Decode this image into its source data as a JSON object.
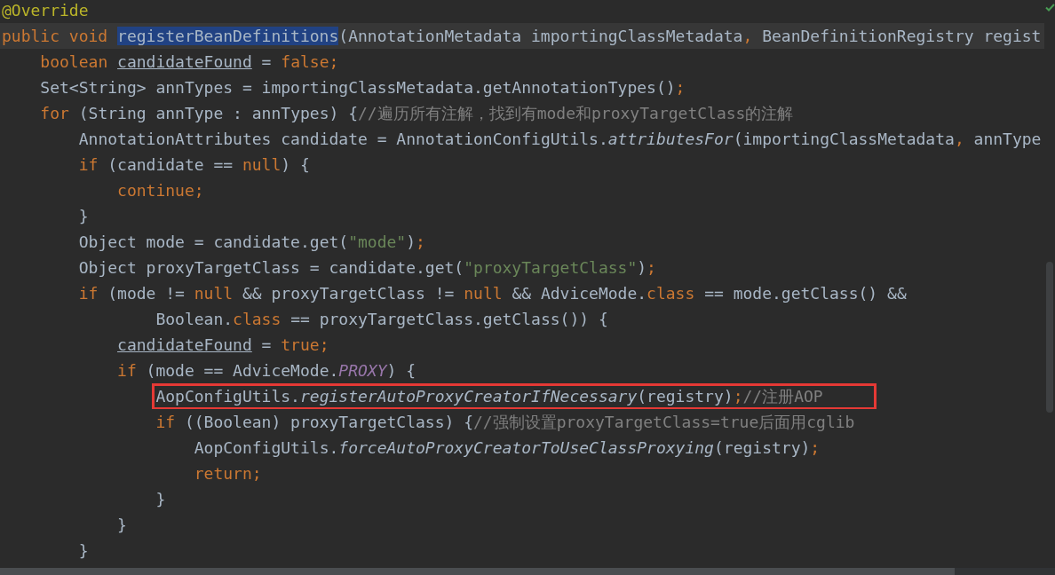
{
  "editor": {
    "lines": [
      {
        "current": false,
        "boxed": false,
        "tokens": [
          {
            "kind": "annotation",
            "text": "@Override"
          }
        ]
      },
      {
        "current": true,
        "boxed": false,
        "tokens": [
          {
            "kind": "keyword",
            "text": "public void "
          },
          {
            "kind": "selected",
            "text": "registerBeanDefinitions"
          },
          {
            "kind": "plain",
            "text": "(AnnotationMetadata importingClassMetadata"
          },
          {
            "kind": "keyword",
            "text": ", "
          },
          {
            "kind": "plain",
            "text": "BeanDefinitionRegistry regist"
          }
        ]
      },
      {
        "current": false,
        "boxed": false,
        "tokens": [
          {
            "kind": "keyword",
            "text": "    boolean "
          },
          {
            "kind": "variable",
            "text": "candidateFound"
          },
          {
            "kind": "plain",
            "text": " = "
          },
          {
            "kind": "keyword",
            "text": "false;"
          }
        ]
      },
      {
        "current": false,
        "boxed": false,
        "tokens": [
          {
            "kind": "plain",
            "text": "    Set<String> annTypes = importingClassMetadata.getAnnotationTypes()"
          },
          {
            "kind": "keyword",
            "text": ";"
          }
        ]
      },
      {
        "current": false,
        "boxed": false,
        "tokens": [
          {
            "kind": "keyword",
            "text": "    for "
          },
          {
            "kind": "plain",
            "text": "(String annType : annTypes) {"
          },
          {
            "kind": "comment",
            "text": "//遍历所有注解，找到有mode和proxyTargetClass的注解"
          }
        ]
      },
      {
        "current": false,
        "boxed": false,
        "tokens": [
          {
            "kind": "plain",
            "text": "        AnnotationAttributes candidate = AnnotationConfigUtils."
          },
          {
            "kind": "method",
            "text": "attributesFor"
          },
          {
            "kind": "plain",
            "text": "(importingClassMetadata"
          },
          {
            "kind": "keyword",
            "text": ", "
          },
          {
            "kind": "plain",
            "text": "annType"
          }
        ]
      },
      {
        "current": false,
        "boxed": false,
        "tokens": [
          {
            "kind": "keyword",
            "text": "        if "
          },
          {
            "kind": "plain",
            "text": "(candidate == "
          },
          {
            "kind": "keyword",
            "text": "null"
          },
          {
            "kind": "plain",
            "text": ") {"
          }
        ]
      },
      {
        "current": false,
        "boxed": false,
        "tokens": [
          {
            "kind": "keyword",
            "text": "            continue;"
          }
        ]
      },
      {
        "current": false,
        "boxed": false,
        "tokens": [
          {
            "kind": "plain",
            "text": "        }"
          }
        ]
      },
      {
        "current": false,
        "boxed": false,
        "tokens": [
          {
            "kind": "plain",
            "text": "        Object mode = candidate.get("
          },
          {
            "kind": "string",
            "text": "\"mode\""
          },
          {
            "kind": "plain",
            "text": ")"
          },
          {
            "kind": "keyword",
            "text": ";"
          }
        ]
      },
      {
        "current": false,
        "boxed": false,
        "tokens": [
          {
            "kind": "plain",
            "text": "        Object proxyTargetClass = candidate.get("
          },
          {
            "kind": "string",
            "text": "\"proxyTargetClass\""
          },
          {
            "kind": "plain",
            "text": ")"
          },
          {
            "kind": "keyword",
            "text": ";"
          }
        ]
      },
      {
        "current": false,
        "boxed": false,
        "tokens": [
          {
            "kind": "keyword",
            "text": "        if "
          },
          {
            "kind": "plain",
            "text": "(mode != "
          },
          {
            "kind": "keyword",
            "text": "null "
          },
          {
            "kind": "plain",
            "text": "&& proxyTargetClass != "
          },
          {
            "kind": "keyword",
            "text": "null "
          },
          {
            "kind": "plain",
            "text": "&& AdviceMode."
          },
          {
            "kind": "keyword",
            "text": "class "
          },
          {
            "kind": "plain",
            "text": "== mode.getClass() &&"
          }
        ]
      },
      {
        "current": false,
        "boxed": false,
        "tokens": [
          {
            "kind": "plain",
            "text": "                Boolean."
          },
          {
            "kind": "keyword",
            "text": "class "
          },
          {
            "kind": "plain",
            "text": "== proxyTargetClass.getClass()) {"
          }
        ]
      },
      {
        "current": false,
        "boxed": false,
        "tokens": [
          {
            "kind": "variable",
            "text": "            candidateFound"
          },
          {
            "kind": "plain",
            "text": " = "
          },
          {
            "kind": "keyword",
            "text": "true;"
          }
        ]
      },
      {
        "current": false,
        "boxed": false,
        "tokens": [
          {
            "kind": "keyword",
            "text": "            if "
          },
          {
            "kind": "plain",
            "text": "(mode == AdviceMode."
          },
          {
            "kind": "constant",
            "text": "PROXY"
          },
          {
            "kind": "plain",
            "text": ") {"
          }
        ]
      },
      {
        "current": false,
        "boxed": true,
        "tokens": [
          {
            "kind": "plain",
            "text": "                AopConfigUtils."
          },
          {
            "kind": "method",
            "text": "registerAutoProxyCreatorIfNecessary"
          },
          {
            "kind": "plain",
            "text": "(registry)"
          },
          {
            "kind": "keyword",
            "text": ";"
          },
          {
            "kind": "comment",
            "text": "//注册AOP"
          }
        ]
      },
      {
        "current": false,
        "boxed": false,
        "tokens": [
          {
            "kind": "keyword",
            "text": "                if "
          },
          {
            "kind": "plain",
            "text": "((Boolean) proxyTargetClass) {"
          },
          {
            "kind": "comment",
            "text": "//强制设置proxyTargetClass=true后面用cglib"
          }
        ]
      },
      {
        "current": false,
        "boxed": false,
        "tokens": [
          {
            "kind": "plain",
            "text": "                    AopConfigUtils."
          },
          {
            "kind": "method",
            "text": "forceAutoProxyCreatorToUseClassProxying"
          },
          {
            "kind": "plain",
            "text": "(registry)"
          },
          {
            "kind": "keyword",
            "text": ";"
          }
        ]
      },
      {
        "current": false,
        "boxed": false,
        "tokens": [
          {
            "kind": "keyword",
            "text": "                    return;"
          }
        ]
      },
      {
        "current": false,
        "boxed": false,
        "tokens": [
          {
            "kind": "plain",
            "text": "                }"
          }
        ]
      },
      {
        "current": false,
        "boxed": false,
        "tokens": [
          {
            "kind": "plain",
            "text": "            }"
          }
        ]
      },
      {
        "current": false,
        "boxed": false,
        "tokens": [
          {
            "kind": "plain",
            "text": "        }"
          }
        ]
      }
    ]
  }
}
